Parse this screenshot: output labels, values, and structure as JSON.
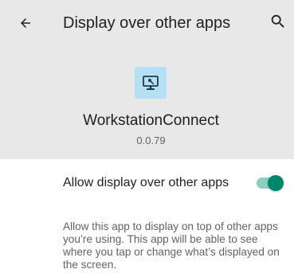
{
  "header": {
    "back_icon": "arrow-back-icon",
    "title": "Display over other apps",
    "search_icon": "search-icon",
    "background": "#e8e8e8"
  },
  "app": {
    "icon": "workstation-remote-desktop-icon",
    "icon_background": "#b3e0f2",
    "name": "WorkstationConnect",
    "version": "0.0.79"
  },
  "setting": {
    "label": "Allow display over other apps",
    "enabled": true,
    "accent": "#00876b",
    "track_color": "#8ccfbf"
  },
  "description": "Allow this app to display on top of other apps you’re using. This app will be able to see where you tap or change what’s displayed on the screen."
}
